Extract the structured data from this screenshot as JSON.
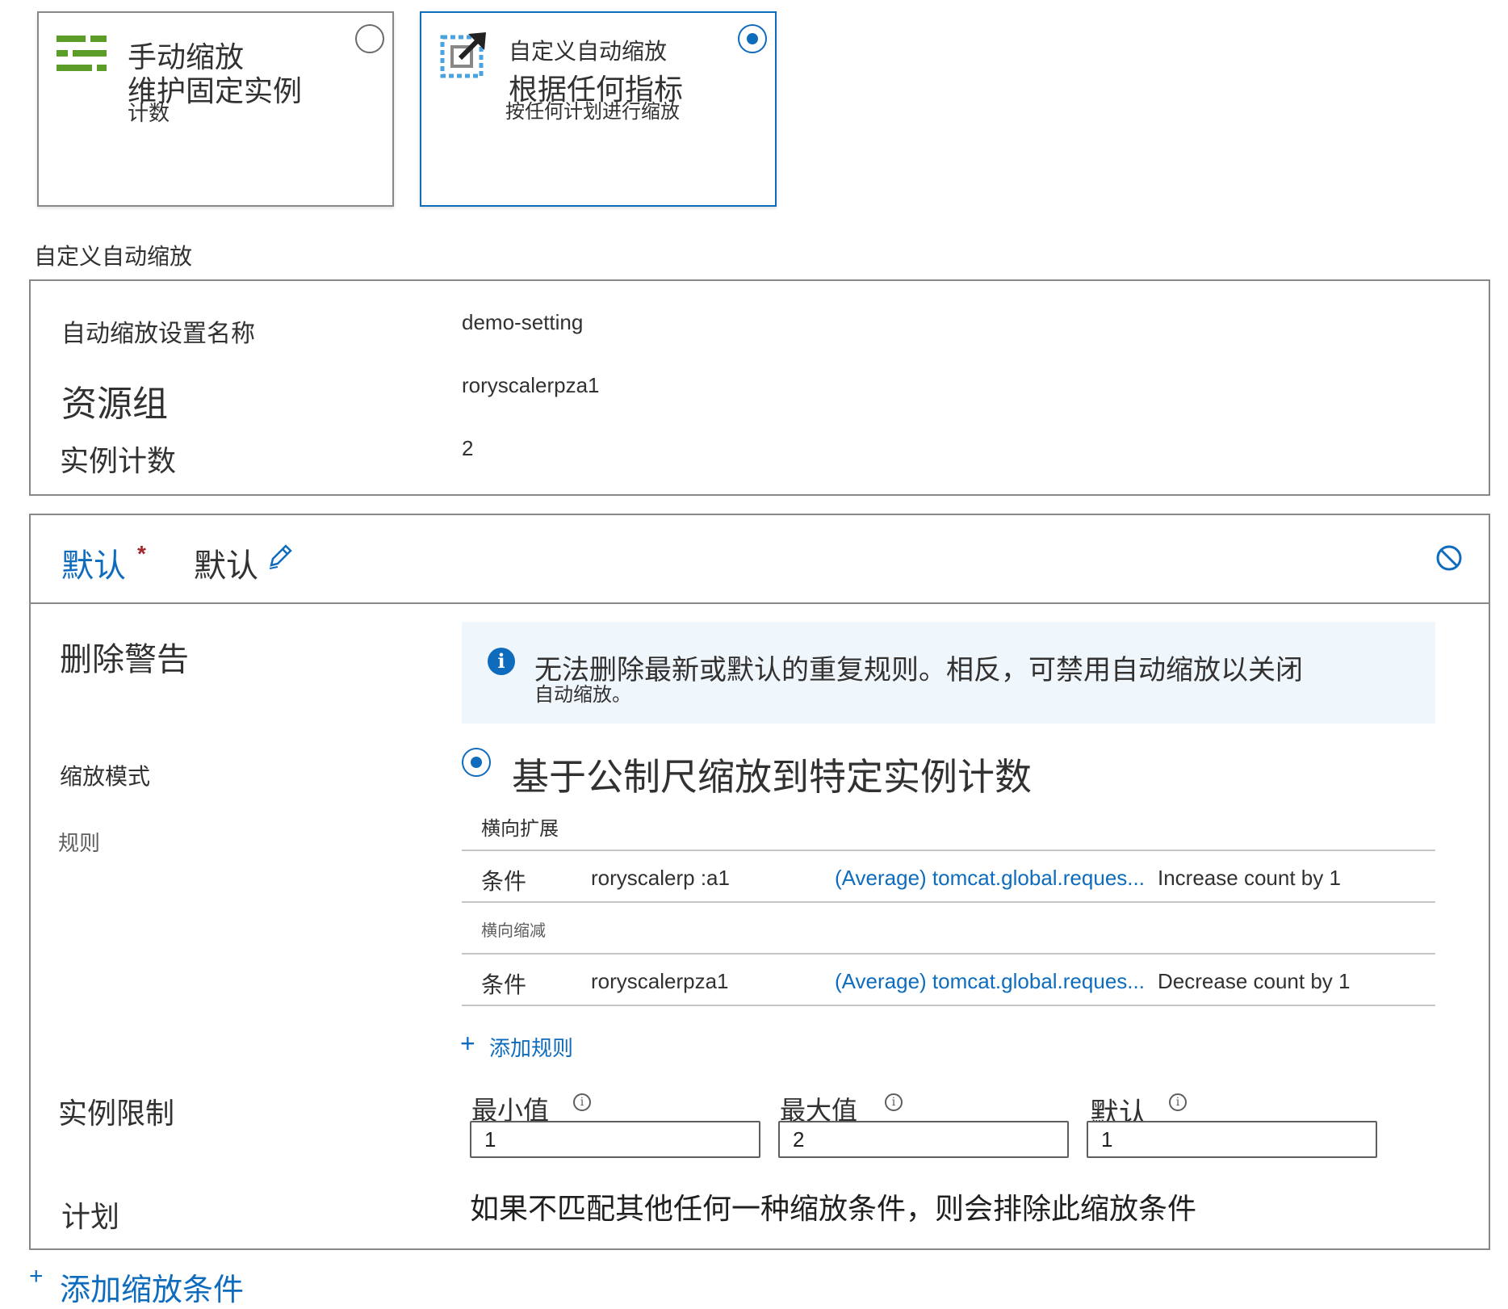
{
  "mode_cards": {
    "manual": {
      "title": "手动缩放",
      "desc_line1": "维护固定实例",
      "desc_line2": "计数",
      "selected": false,
      "icon": "bars-icon"
    },
    "custom": {
      "title": "自定义自动缩放",
      "desc_line1": "根据任何指标",
      "desc_line2": "按任何计划进行缩放",
      "selected": true,
      "icon": "scale-arrow-icon"
    }
  },
  "section_title": "自定义自动缩放",
  "settings": {
    "name_label": "自动缩放设置名称",
    "name_value": "demo-setting",
    "resource_group_label": "资源组",
    "resource_group_value": "roryscalerpza1",
    "instance_count_label": "实例计数",
    "instance_count_value": "2"
  },
  "condition": {
    "tab_label": "默认",
    "required_marker": "*",
    "name": "默认",
    "delete_warning_label": "删除警告",
    "info_line1": "无法删除最新或默认的重复规则。相反，可禁用自动缩放以关闭",
    "info_line2": "自动缩放。",
    "scale_mode_label": "缩放模式",
    "scale_mode_option": "基于公制尺缩放到特定实例计数",
    "rules_label": "规则",
    "scale_out_header": "横向扩展",
    "scale_in_header": "横向缩减",
    "rules": [
      {
        "condition_label": "条件",
        "resource": "roryscalerp :a1",
        "metric": "(Average) tomcat.global.reques...",
        "action": "Increase count by 1"
      },
      {
        "condition_label": "条件",
        "resource": "roryscalerpza1",
        "metric": "(Average) tomcat.global.reques...",
        "action": "Decrease count by 1"
      }
    ],
    "add_rule": "添加规则",
    "instance_limits_label": "实例限制",
    "min_label": "最小值",
    "min_value": "1",
    "max_label": "最大值",
    "max_value": "2",
    "default_label": "默认",
    "default_value": "1",
    "schedule_label": "计划",
    "schedule_text": "如果不匹配其他任何一种缩放条件，则会排除此缩放条件"
  },
  "add_condition": "添加缩放条件",
  "colors": {
    "accent": "#0f6cbd",
    "info_bg": "#eff6fc",
    "green_icon": "#5c9d2a",
    "border": "#8a8886"
  }
}
